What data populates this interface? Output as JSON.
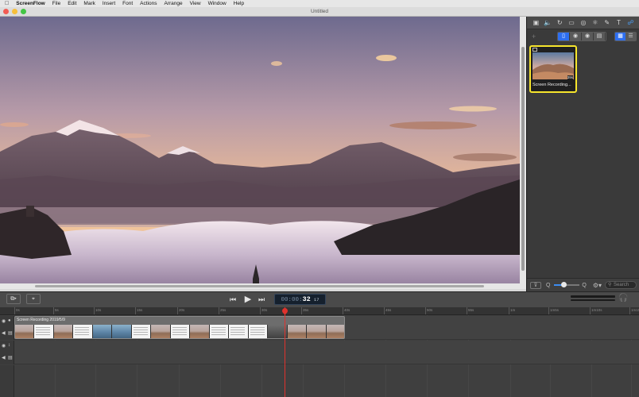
{
  "menubar": {
    "apple_icon": "apple-icon",
    "items": [
      "ScreenFlow",
      "File",
      "Edit",
      "Mark",
      "Insert",
      "Font",
      "Actions",
      "Arrange",
      "View",
      "Window",
      "Help"
    ]
  },
  "window": {
    "title": "Untitled",
    "traffic_lights": {
      "close": "#f25c54",
      "minimize": "#f7bf3a",
      "zoom": "#43c645"
    }
  },
  "inspector": {
    "toolbar_icons": [
      "video-properties-icon",
      "audio-properties-icon",
      "video-motion-icon",
      "screen-recording-icon",
      "callout-icon",
      "touch-callout-icon",
      "annotations-icon",
      "text-icon",
      "media-library-icon"
    ],
    "add_label": "+",
    "view_modes": [
      "device-icon",
      "record-screen-icon",
      "record-camera-icon",
      "record-audio-icon"
    ],
    "layout_modes": [
      "grid-view-icon",
      "list-view-icon"
    ],
    "media": {
      "caption": "Screen Recording...",
      "duration": "39s"
    },
    "footer": {
      "filter_label": "⊽",
      "zoom_min": "Q",
      "zoom_max": "Q",
      "zoom_level": 0.35,
      "search_placeholder": "Search"
    }
  },
  "transport": {
    "rewind_icon": "⏮",
    "play_icon": "▶",
    "forward_icon": "⏭",
    "timecode_dim": "00:00:",
    "timecode_bright": "32",
    "timecode_frames": "17",
    "headphones_icon": "headphones-icon"
  },
  "timeline": {
    "ruler": [
      "0s",
      "5s",
      "10s",
      "15s",
      "20s",
      "25s",
      "30s",
      "35s",
      "40s",
      "45s",
      "50s",
      "55s",
      "1m",
      "1m5s",
      "1m10s",
      "1m15s"
    ],
    "clip_label": "Screen Recording 2019/5/9",
    "playhead_time": "32s"
  },
  "colors": {
    "accent": "#2d6ef0",
    "selection": "#f6e52c",
    "playhead": "#e0322d"
  }
}
